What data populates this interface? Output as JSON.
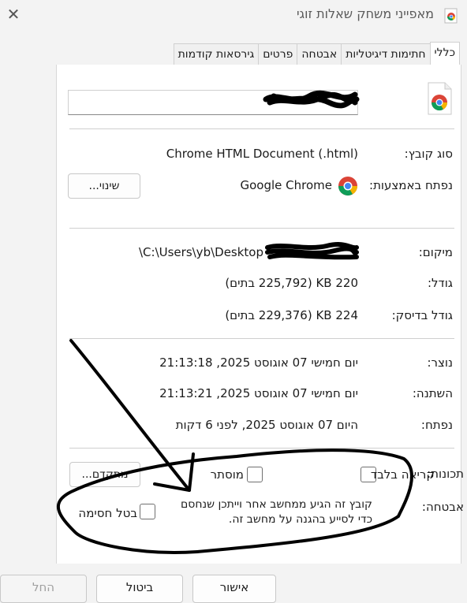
{
  "window": {
    "title": "מאפייני משחק שאלות זוגי",
    "close_icon": "close-icon",
    "app_icon": "chrome-icon"
  },
  "tabs": [
    {
      "label": "כללי"
    },
    {
      "label": "חתימות דיגיטליות"
    },
    {
      "label": "אבטחה"
    },
    {
      "label": "פרטים"
    },
    {
      "label": "גירסאות קודמות"
    }
  ],
  "general": {
    "file_name": "",
    "file_type_label": "סוג קובץ:",
    "file_type_value": "Chrome HTML Document (.html)",
    "opens_with_label": "נפתח באמצעות:",
    "opens_with_value": "Google Chrome",
    "change_button": "שינוי...",
    "location_label": "מיקום:",
    "location_value": "C:\\Users\\yb\\Desktop\\",
    "size_label": "גודל:",
    "size_value": "220 KB (225,792 בתים)",
    "size_on_disk_label": "גודל בדיסק:",
    "size_on_disk_value": "224 KB (229,376 בתים)",
    "created_label": "נוצר:",
    "created_value": "יום חמישי 07 אוגוסט 2025, 21:13:18",
    "modified_label": "השתנה:",
    "modified_value": "יום חמישי 07 אוגוסט 2025, 21:13:21",
    "accessed_label": "נפתח:",
    "accessed_value": "היום 07 אוגוסט 2025, לפני 6 דקות",
    "attributes_label": "תכונות:",
    "readonly_label": "קריאה בלבד",
    "hidden_label": "מוסתר",
    "advanced_button": "מתקדם...",
    "security_label": "אבטחה:",
    "security_text_1": "קובץ זה הגיע ממחשב אחר וייתכן שנחסם",
    "security_text_2": "כדי לסייע בהגנה על מחשב זה.",
    "unblock_label": "בטל חסימה"
  },
  "footer": {
    "ok": "אישור",
    "cancel": "ביטול",
    "apply": "החל"
  }
}
